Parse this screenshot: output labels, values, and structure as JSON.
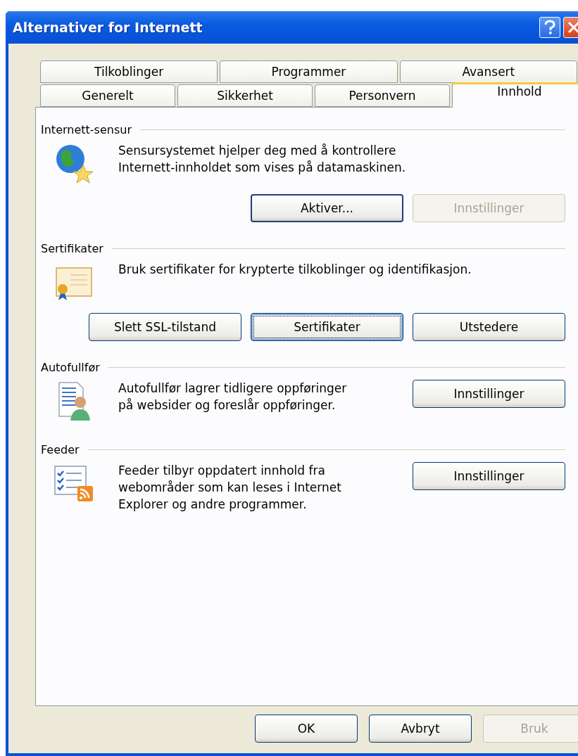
{
  "window": {
    "title": "Alternativer for Internett"
  },
  "tab_rows": [
    [
      {
        "label": "Tilkoblinger",
        "selected": false
      },
      {
        "label": "Programmer",
        "selected": false
      },
      {
        "label": "Avansert",
        "selected": false
      }
    ],
    [
      {
        "label": "Generelt",
        "selected": false
      },
      {
        "label": "Sikkerhet",
        "selected": false
      },
      {
        "label": "Personvern",
        "selected": false
      },
      {
        "label": "Innhold",
        "selected": true
      }
    ]
  ],
  "sections": [
    {
      "title": "Internett-sensur",
      "kind": "stacked",
      "text": [
        "Sensursystemet hjelper deg med å kontrollere",
        "Internett-innholdet som vises på datamaskinen."
      ],
      "buttons": [
        {
          "label": "Aktiver...",
          "disabled": false,
          "focused": false,
          "default": true
        },
        {
          "label": "Innstillinger",
          "disabled": true,
          "focused": false,
          "default": false
        }
      ]
    },
    {
      "title": "Sertifikater",
      "kind": "stacked",
      "text": [
        "Bruk sertifikater for krypterte tilkoblinger og identifikasjon."
      ],
      "buttons": [
        {
          "label": "Slett SSL-tilstand",
          "disabled": false,
          "focused": false,
          "default": false
        },
        {
          "label": "Sertifikater",
          "disabled": false,
          "focused": true,
          "default": false
        },
        {
          "label": "Utstedere",
          "disabled": false,
          "focused": false,
          "default": false
        }
      ]
    },
    {
      "title": "Autofullfør",
      "kind": "side",
      "text": [
        "Autofullfør lagrer tidligere oppføringer",
        "på websider og foreslår oppføringer."
      ],
      "buttons": [
        {
          "label": "Innstillinger",
          "disabled": false,
          "focused": false,
          "default": false
        }
      ]
    },
    {
      "title": "Feeder",
      "kind": "side",
      "text": [
        "Feeder tilbyr oppdatert innhold fra",
        "webområder som kan leses i Internet",
        "Explorer og andre programmer."
      ],
      "buttons": [
        {
          "label": "Innstillinger",
          "disabled": false,
          "focused": false,
          "default": false
        }
      ]
    }
  ],
  "dialog_buttons": [
    {
      "label": "OK",
      "disabled": false,
      "focused": false,
      "default": false
    },
    {
      "label": "Avbryt",
      "disabled": false,
      "focused": false,
      "default": false
    },
    {
      "label": "Bruk",
      "disabled": true,
      "focused": false,
      "default": false
    }
  ]
}
